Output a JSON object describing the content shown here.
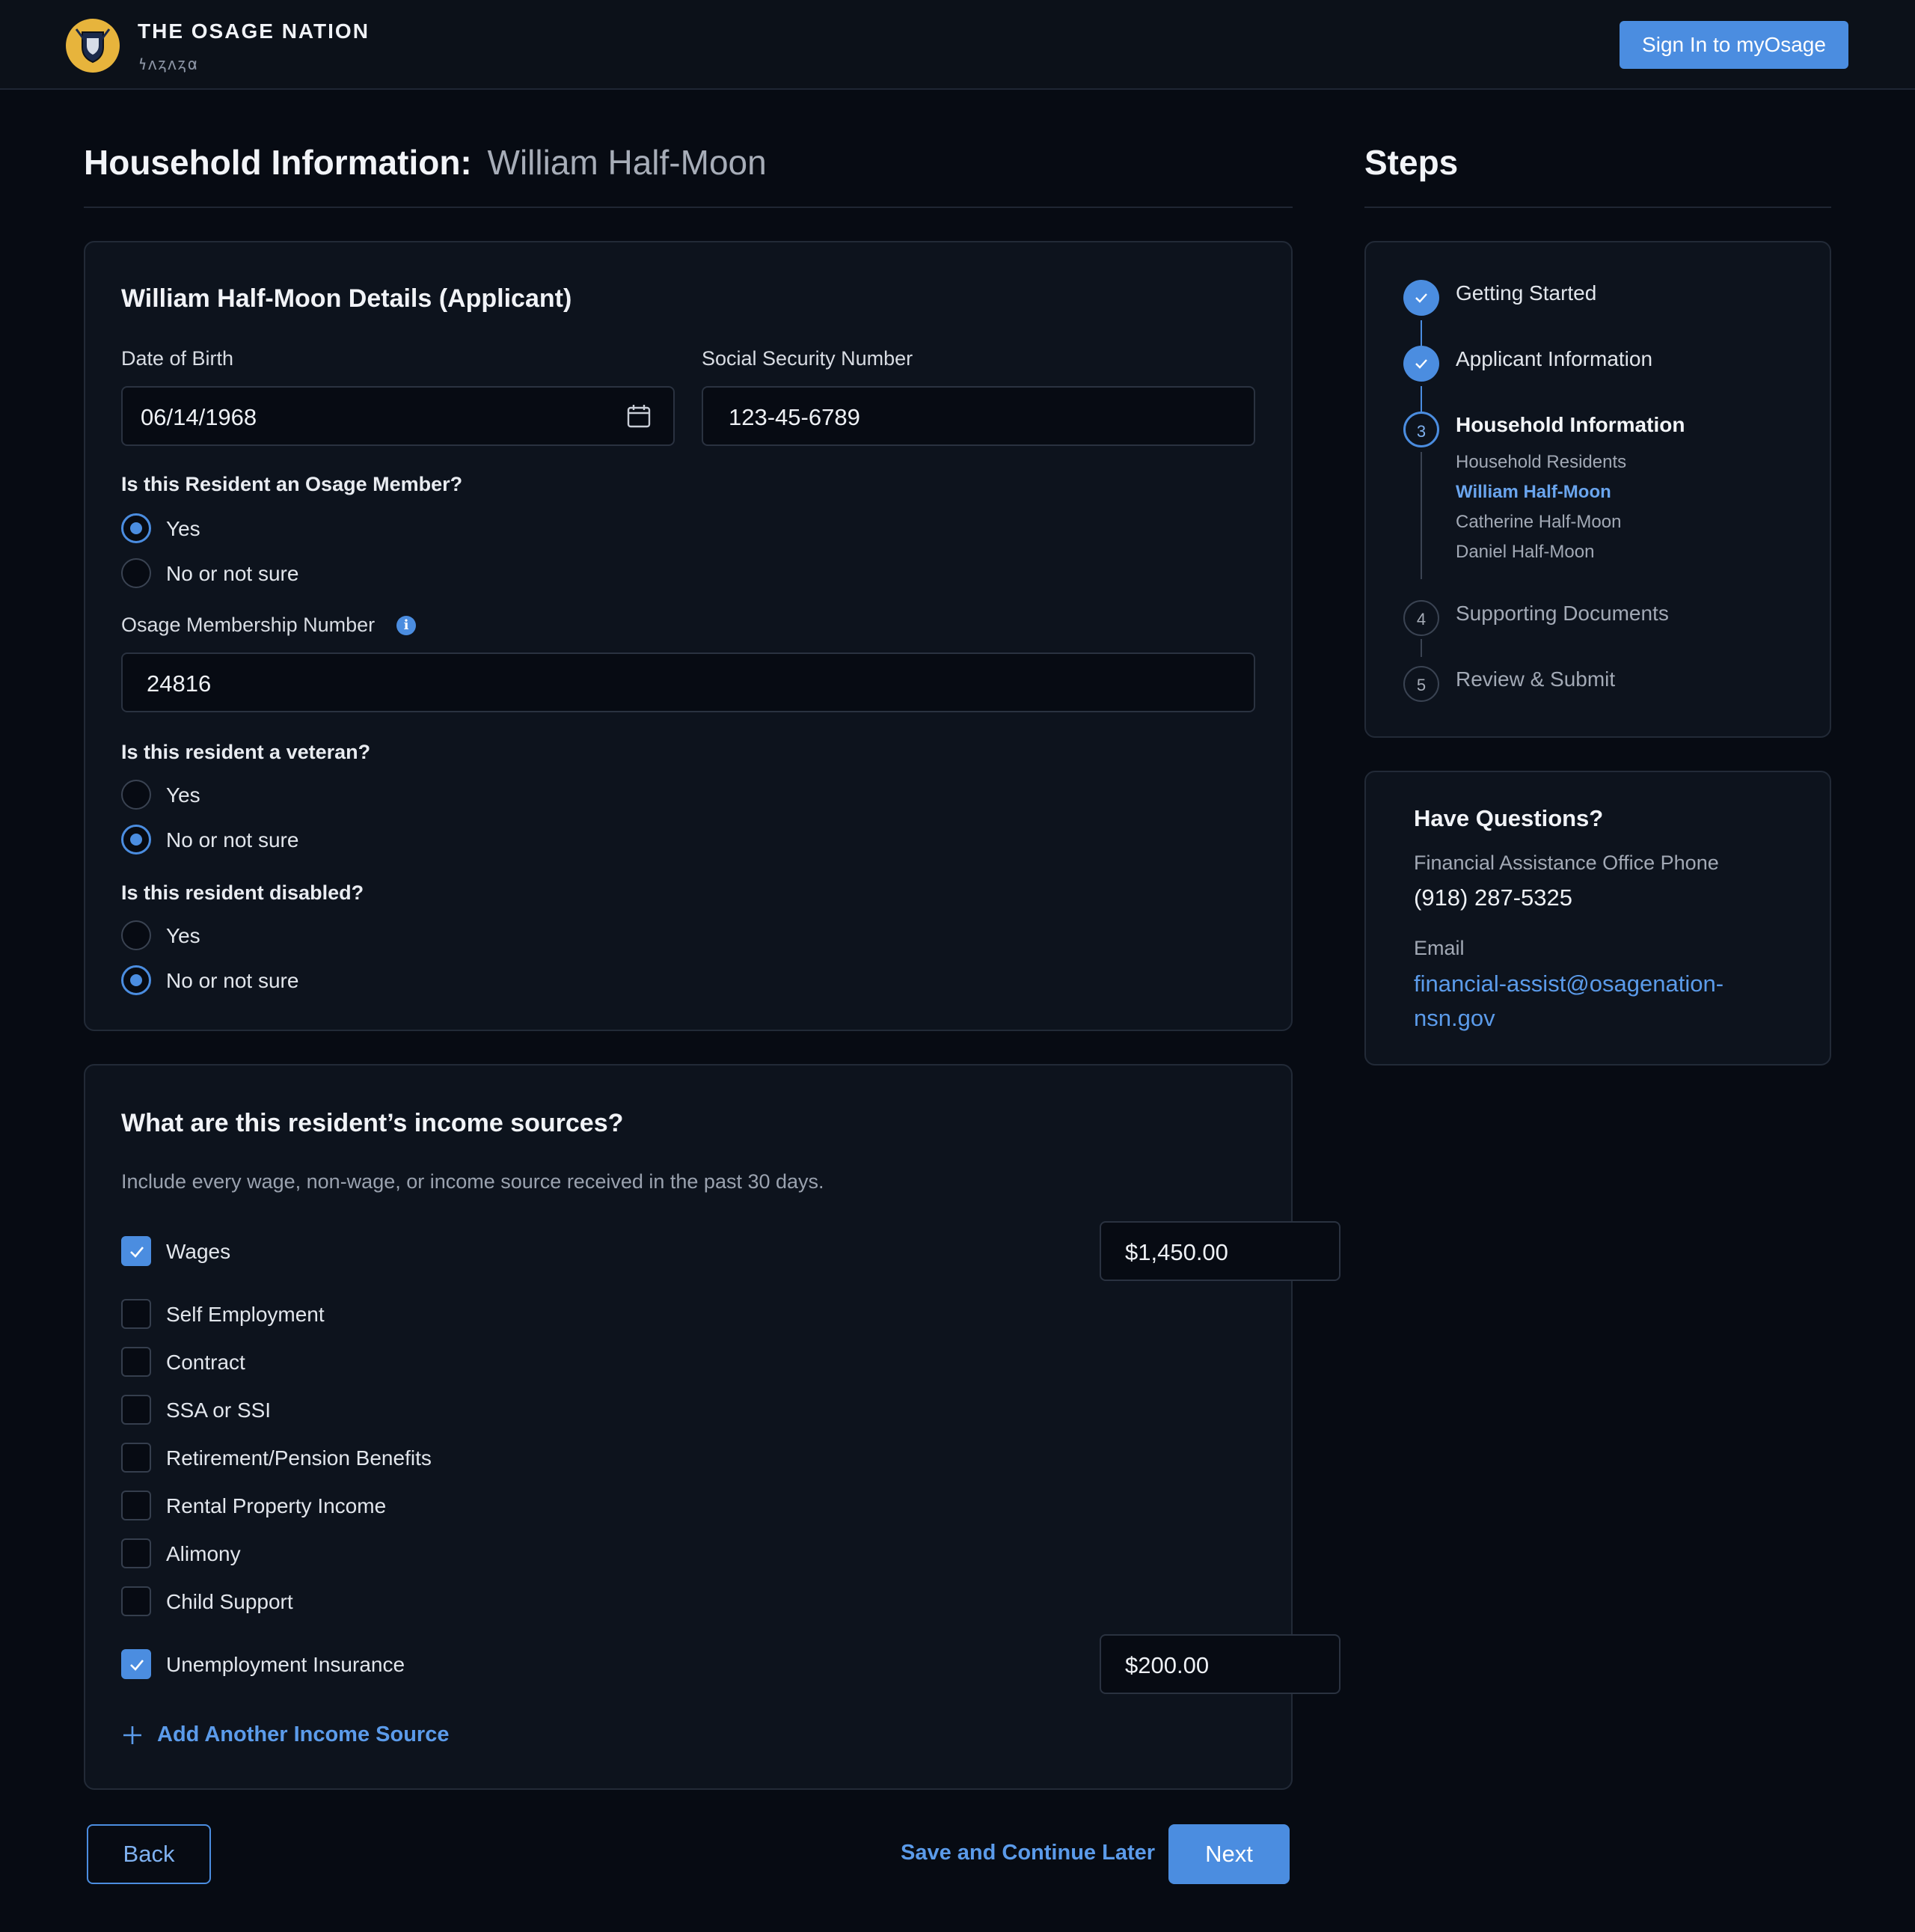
{
  "header": {
    "org_name": "THE OSAGE NATION",
    "org_subtitle": "𐓏𐓘𐓻𐓘𐓻𐓟",
    "sign_in_label": "Sign In to myOsage"
  },
  "page": {
    "title": "Household Information:",
    "resident_name": "William Half-Moon"
  },
  "details": {
    "heading": "William Half-Moon Details (Applicant)",
    "dob_label": "Date of Birth",
    "dob_value": "06/14/1968",
    "ssn_label": "Social Security Number",
    "ssn_value": "123-45-6789",
    "member_question": "Is this Resident an Osage Member?",
    "member_options": [
      "Yes",
      "No or not sure"
    ],
    "member_selected": "Yes",
    "membership_label": "Osage Membership Number",
    "membership_value": "24816",
    "veteran_question": "Is this resident a veteran?",
    "veteran_options": [
      "Yes",
      "No or not sure"
    ],
    "veteran_selected": "No or not sure",
    "disabled_question": "Is this resident disabled?",
    "disabled_options": [
      "Yes",
      "No or not sure"
    ],
    "disabled_selected": "No or not sure"
  },
  "income": {
    "heading": "What are this resident’s income sources?",
    "help": "Include every wage, non-wage, or income source received in the past 30 days.",
    "sources": [
      {
        "label": "Wages",
        "checked": true,
        "amount": "$1,450.00"
      },
      {
        "label": "Self Employment",
        "checked": false
      },
      {
        "label": "Contract",
        "checked": false
      },
      {
        "label": "SSA or SSI",
        "checked": false
      },
      {
        "label": "Retirement/Pension Benefits",
        "checked": false
      },
      {
        "label": "Rental Property Income",
        "checked": false
      },
      {
        "label": "Alimony",
        "checked": false
      },
      {
        "label": "Child Support",
        "checked": false
      },
      {
        "label": "Unemployment Insurance",
        "checked": true,
        "amount": "$200.00"
      }
    ],
    "add_label": "Add Another Income Source"
  },
  "footer": {
    "back_label": "Back",
    "save_label": "Save and Continue Later",
    "next_label": "Next"
  },
  "steps": {
    "title": "Steps",
    "items": [
      {
        "label": "Getting Started",
        "state": "done"
      },
      {
        "label": "Applicant Information",
        "state": "done"
      },
      {
        "label": "Household Information",
        "state": "current",
        "number": "3"
      },
      {
        "label": "Supporting Documents",
        "state": "todo",
        "number": "4"
      },
      {
        "label": "Review & Submit",
        "state": "todo",
        "number": "5"
      }
    ],
    "substeps": [
      "Household Residents",
      "William Half-Moon",
      "Catherine Half-Moon",
      "Daniel Half-Moon"
    ],
    "active_substep": "William Half-Moon"
  },
  "questions": {
    "heading": "Have Questions?",
    "phone_label": "Financial Assistance Office Phone",
    "phone": "(918) 287-5325",
    "email_label": "Email",
    "email_line1": "financial-assist@osagenation-",
    "email_line2": "nsn.gov"
  },
  "colors": {
    "accent": "#4b8de0",
    "background": "#070b13",
    "card": "#0d131d",
    "logo_gold": "#e7b43c"
  }
}
